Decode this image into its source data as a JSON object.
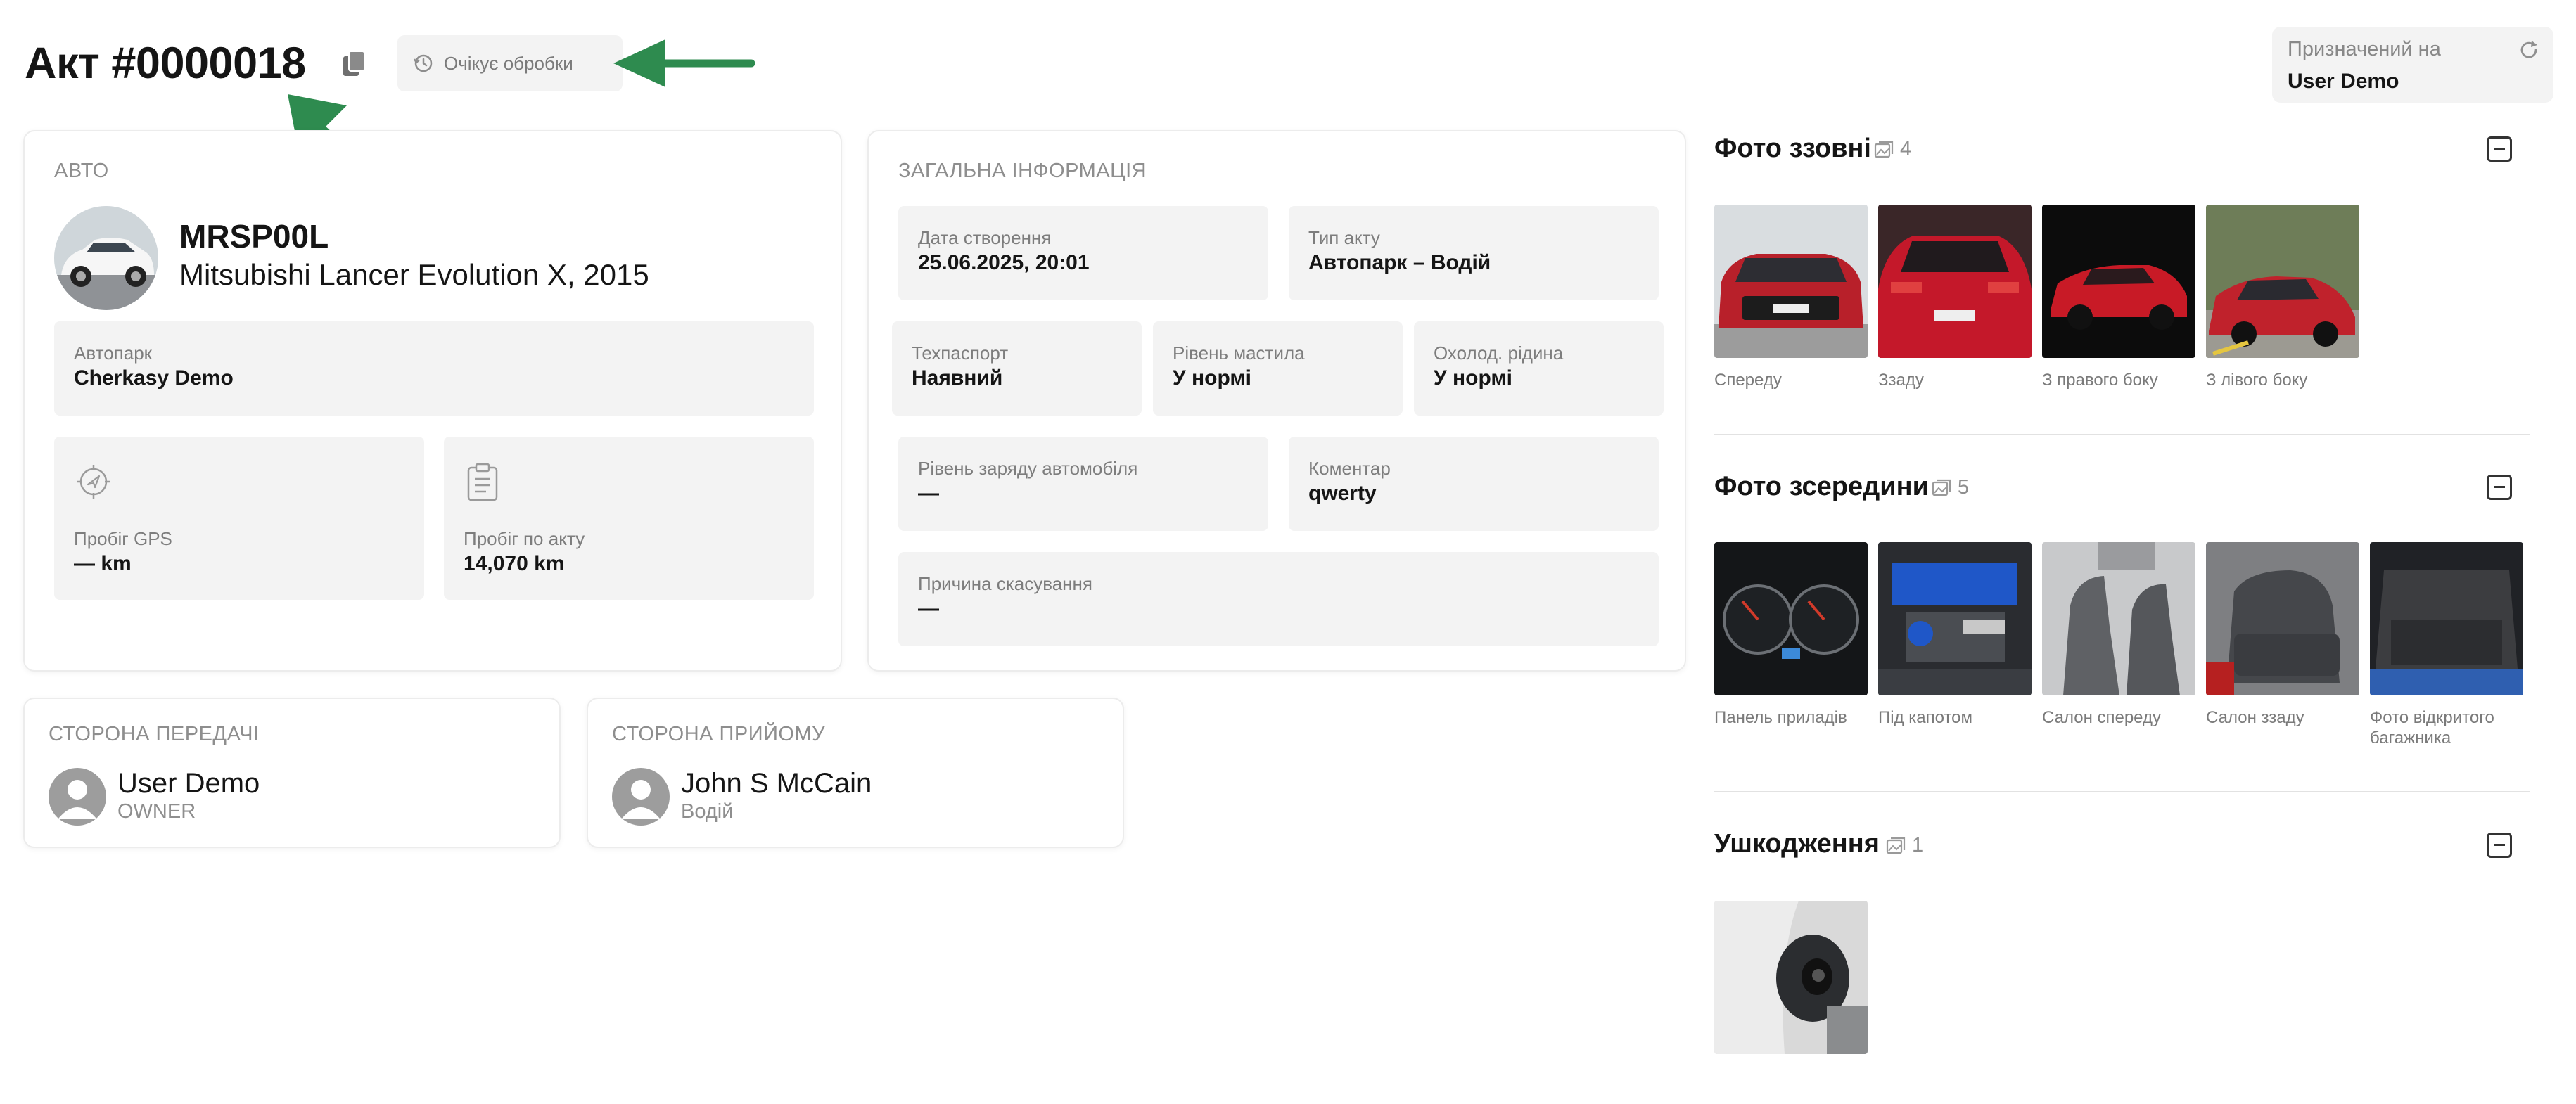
{
  "header": {
    "title": "Акт #0000018",
    "status": "Очікує обробки",
    "assigned_label": "Призначений на",
    "assigned_value": "User Demo"
  },
  "car": {
    "section_title": "АВТО",
    "plate": "MRSP00L",
    "model": "Mitsubishi Lancer Evolution X, 2015",
    "fleet_label": "Автопарк",
    "fleet_value": "Cherkasy Demo",
    "gps_label": "Пробіг GPS",
    "gps_value": "— km",
    "act_mileage_label": "Пробіг по акту",
    "act_mileage_value": "14,070 km"
  },
  "general": {
    "section_title": "ЗАГАЛЬНА ІНФОРМАЦІЯ",
    "created_label": "Дата створення",
    "created_value": "25.06.2025, 20:01",
    "type_label": "Тип акту",
    "type_value": "Автопарк – Водій",
    "passport_label": "Техпаспорт",
    "passport_value": "Наявний",
    "oil_label": "Рівень мастила",
    "oil_value": "У нормі",
    "coolant_label": "Охолод. рідина",
    "coolant_value": "У нормі",
    "charge_label": "Рівень заряду автомобіля",
    "charge_value": "—",
    "comment_label": "Коментар",
    "comment_value": "qwerty",
    "cancel_label": "Причина скасування",
    "cancel_value": "—"
  },
  "transfer": {
    "title": "СТОРОНА ПЕРЕДАЧІ",
    "name": "User Demo",
    "role": "OWNER"
  },
  "receive": {
    "title": "СТОРОНА ПРИЙОМУ",
    "name": "John S McCain",
    "role": "Водій"
  },
  "photos_outside": {
    "title": "Фото ззовні",
    "count": "4",
    "captions": [
      "Спереду",
      "Ззаду",
      "З правого боку",
      "З лівого боку"
    ]
  },
  "photos_inside": {
    "title": "Фото зсередини",
    "count": "5",
    "captions": [
      "Панель приладів",
      "Під капотом",
      "Салон спереду",
      "Салон ззаду",
      "Фото відкритого багажника"
    ]
  },
  "damages": {
    "title": "Ушкодження",
    "count": "1"
  },
  "colors": {
    "accent_arrow": "#2e8b4f",
    "card_border": "#ececec",
    "field_bg": "#f3f3f3"
  }
}
